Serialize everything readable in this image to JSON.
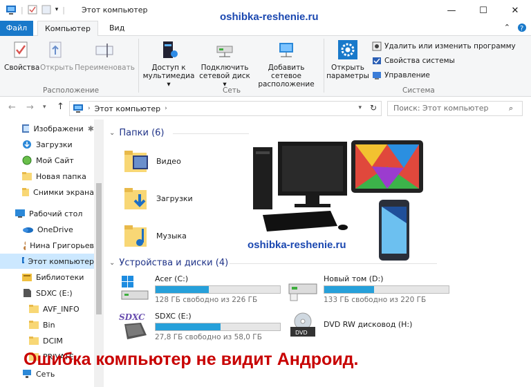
{
  "window": {
    "title": "Этот компьютер",
    "watermark": "oshibka-reshenie.ru",
    "controls": {
      "minimize": "—",
      "maximize": "☐",
      "close": "✕"
    }
  },
  "tabs": [
    {
      "label": "Файл"
    },
    {
      "label": "Компьютер"
    },
    {
      "label": "Вид"
    }
  ],
  "ribbon": {
    "location": {
      "properties": "Свойства",
      "open": "Открыть",
      "rename": "Переименовать",
      "group": "Расположение"
    },
    "network": {
      "media_l1": "Доступ к",
      "media_l2": "мультимедиа",
      "map_l1": "Подключить",
      "map_l2": "сетевой диск",
      "add_l1": "Добавить сетевое",
      "add_l2": "расположение",
      "group": "Сеть"
    },
    "system": {
      "open_l1": "Открыть",
      "open_l2": "параметры",
      "uninstall": "Удалить или изменить программу",
      "sysprops": "Свойства системы",
      "manage": "Управление",
      "group": "Система"
    }
  },
  "address": {
    "path": "Этот компьютер",
    "search_placeholder": "Поиск: Этот компьютер"
  },
  "nav": [
    {
      "label": "Изображени"
    },
    {
      "label": "Загрузки"
    },
    {
      "label": "Мой Сайт"
    },
    {
      "label": "Новая папка"
    },
    {
      "label": "Снимки экрана"
    },
    {
      "label": "Рабочий стол"
    },
    {
      "label": "OneDrive"
    },
    {
      "label": "Нина Григорьев"
    },
    {
      "label": "Этот компьютер"
    },
    {
      "label": "Библиотеки"
    },
    {
      "label": "SDXC (E:)"
    },
    {
      "label": "AVF_INFO"
    },
    {
      "label": "Bin"
    },
    {
      "label": "DCIM"
    },
    {
      "label": "PRIVATE"
    },
    {
      "label": "Сеть"
    }
  ],
  "folders_header": "Папки (6)",
  "folders": [
    {
      "label": "Видео"
    },
    {
      "label": "Загрузки"
    },
    {
      "label": "Музыка"
    }
  ],
  "devices_header": "Устройства и диски (4)",
  "drives": [
    {
      "label": "Acer (C:)",
      "free": "128 ГБ свободно из 226 ГБ",
      "used_fraction": 0.43
    },
    {
      "label": "Новый том (D:)",
      "free": "133 ГБ свободно из 220 ГБ",
      "used_fraction": 0.4
    },
    {
      "label": "SDXC (E:)",
      "free": "27,8 ГБ свободно из 58,0 ГБ",
      "used_fraction": 0.52
    },
    {
      "label": "DVD RW дисковод (H:)"
    }
  ],
  "sdxc_logo": "SDXC",
  "dvd_logo": "DVD",
  "headline": "Ошибка компьютер не видит Андроид."
}
